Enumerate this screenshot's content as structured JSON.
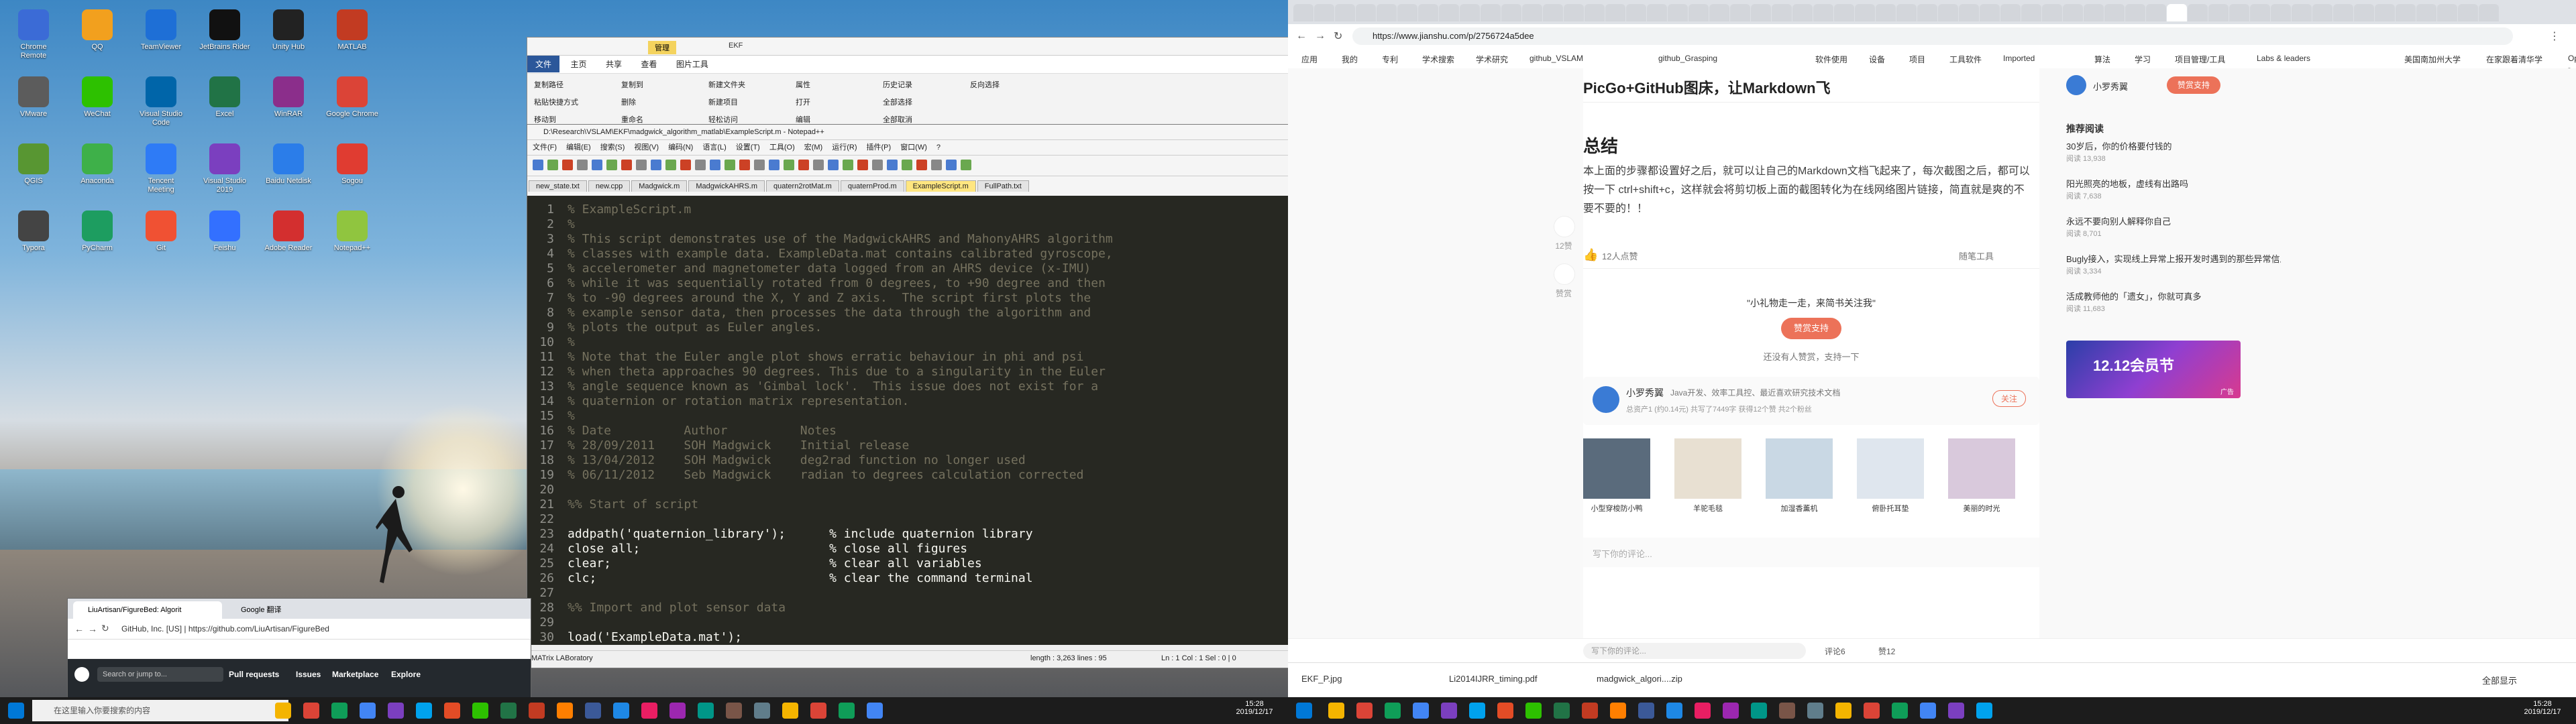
{
  "desktop": {
    "icons": [
      {
        "label": "Chrome Remote Desktop",
        "color": "#3b6bd6"
      },
      {
        "label": "QQ",
        "color": "#f2a01e"
      },
      {
        "label": "TeamViewer",
        "color": "#1e6fd6"
      },
      {
        "label": "JetBrains Rider",
        "color": "#111"
      },
      {
        "label": "Unity Hub",
        "color": "#222"
      },
      {
        "label": "MATLAB",
        "color": "#c23b22"
      },
      {
        "label": "VMware",
        "color": "#5c5c5c"
      },
      {
        "label": "WeChat",
        "color": "#2dc100"
      },
      {
        "label": "Visual Studio Code",
        "color": "#0065a9"
      },
      {
        "label": "Excel",
        "color": "#217346"
      },
      {
        "label": "WinRAR",
        "color": "#8b2e8b"
      },
      {
        "label": "Google Chrome",
        "color": "#db4437"
      },
      {
        "label": "QGIS",
        "color": "#589632"
      },
      {
        "label": "Anaconda",
        "color": "#3eb049"
      },
      {
        "label": "Tencent Meeting",
        "color": "#2e7bf6"
      },
      {
        "label": "Visual Studio 2019",
        "color": "#7b3fbf"
      },
      {
        "label": "Baidu Netdisk",
        "color": "#2b7de9"
      },
      {
        "label": "Sogou",
        "color": "#e03c31"
      },
      {
        "label": "Typora",
        "color": "#444"
      },
      {
        "label": "PyCharm",
        "color": "#1d9d60"
      },
      {
        "label": "Git",
        "color": "#f05133"
      },
      {
        "label": "Feishu",
        "color": "#3370ff"
      },
      {
        "label": "Adobe Reader",
        "color": "#d32f2f"
      },
      {
        "label": "Notepad++",
        "color": "#90c53f"
      }
    ]
  },
  "explorer": {
    "title": "EKF",
    "tabs": [
      "文件",
      "主页",
      "共享",
      "查看",
      "图片工具"
    ],
    "manage_tab": "管理",
    "actions": [
      "复制路径",
      "粘贴快捷方式",
      "移动到",
      "复制到",
      "删除",
      "重命名",
      "新建文件夹",
      "新建项目",
      "轻松访问",
      "属性",
      "打开",
      "编辑",
      "历史记录",
      "全部选择",
      "全部取消",
      "反向选择"
    ]
  },
  "notepad": {
    "title": "D:\\Research\\VSLAM\\EKF\\madgwick_algorithm_matlab\\ExampleScript.m - Notepad++",
    "menu": [
      "文件(F)",
      "编辑(E)",
      "搜索(S)",
      "视图(V)",
      "编码(N)",
      "语言(L)",
      "设置(T)",
      "工具(O)",
      "宏(M)",
      "运行(R)",
      "插件(P)",
      "窗口(W)",
      "?"
    ],
    "tabs": [
      "new_state.txt",
      "new.cpp",
      "Madgwick.m",
      "MadgwickAHRS.m",
      "quatern2rotMat.m",
      "quaternProd.m",
      "ExampleScript.m",
      "FullPath.txt"
    ],
    "active_tab": "ExampleScript.m",
    "lines": [
      {
        "n": "1",
        "text": "% ExampleScript.m",
        "kind": "comment"
      },
      {
        "n": "2",
        "text": "%",
        "kind": "comment"
      },
      {
        "n": "3",
        "text": "% This script demonstrates use of the MadgwickAHRS and MahonyAHRS algorithm",
        "kind": "comment"
      },
      {
        "n": "4",
        "text": "% classes with example data. ExampleData.mat contains calibrated gyroscope,",
        "kind": "comment"
      },
      {
        "n": "5",
        "text": "% accelerometer and magnetometer data logged from an AHRS device (x-IMU)",
        "kind": "comment"
      },
      {
        "n": "6",
        "text": "% while it was sequentially rotated from 0 degrees, to +90 degree and then",
        "kind": "comment"
      },
      {
        "n": "7",
        "text": "% to -90 degrees around the X, Y and Z axis.  The script first plots the",
        "kind": "comment"
      },
      {
        "n": "8",
        "text": "% example sensor data, then processes the data through the algorithm and",
        "kind": "comment"
      },
      {
        "n": "9",
        "text": "% plots the output as Euler angles.",
        "kind": "comment"
      },
      {
        "n": "10",
        "text": "%",
        "kind": "comment"
      },
      {
        "n": "11",
        "text": "% Note that the Euler angle plot shows erratic behaviour in phi and psi",
        "kind": "comment"
      },
      {
        "n": "12",
        "text": "% when theta approaches 90 degrees. This due to a singularity in the Euler",
        "kind": "comment"
      },
      {
        "n": "13",
        "text": "% angle sequence known as 'Gimbal lock'.  This issue does not exist for a",
        "kind": "comment"
      },
      {
        "n": "14",
        "text": "% quaternion or rotation matrix representation.",
        "kind": "comment"
      },
      {
        "n": "15",
        "text": "%",
        "kind": "comment"
      },
      {
        "n": "16",
        "text": "% Date          Author          Notes",
        "kind": "comment"
      },
      {
        "n": "17",
        "text": "% 28/09/2011    SOH Madgwick    Initial release",
        "kind": "comment"
      },
      {
        "n": "18",
        "text": "% 13/04/2012    SOH Madgwick    deg2rad function no longer used",
        "kind": "comment"
      },
      {
        "n": "19",
        "text": "% 06/11/2012    Seb Madgwick    radian to degrees calculation corrected",
        "kind": "comment"
      },
      {
        "n": "20",
        "text": "",
        "kind": "comment"
      },
      {
        "n": "21",
        "text": "%% Start of script",
        "kind": "comment"
      },
      {
        "n": "22",
        "text": "",
        "kind": "comment"
      },
      {
        "n": "23",
        "text": "addpath('quaternion_library');      % include quaternion library",
        "kind": "code"
      },
      {
        "n": "24",
        "text": "close all;                          % close all figures",
        "kind": "code"
      },
      {
        "n": "25",
        "text": "clear;                              % clear all variables",
        "kind": "code"
      },
      {
        "n": "26",
        "text": "clc;                                % clear the command terminal",
        "kind": "code"
      },
      {
        "n": "27",
        "text": "",
        "kind": "comment"
      },
      {
        "n": "28",
        "text": "%% Import and plot sensor data",
        "kind": "comment"
      },
      {
        "n": "29",
        "text": "",
        "kind": "comment"
      },
      {
        "n": "30",
        "text": "load('ExampleData.mat');",
        "kind": "code"
      }
    ],
    "status": {
      "lang": "MATrix LABoratory",
      "length": "length : 3,263    lines : 95",
      "pos": "Ln : 1    Col : 1    Sel : 0 | 0"
    }
  },
  "github_window": {
    "tab1": "LiuArtisan/FigureBed: Algorit",
    "tab2": "Google 翻译",
    "url": "GitHub, Inc. [US] | https://github.com/LiuArtisan/FigureBed",
    "search": "Search or jump to...",
    "nav": [
      "Pull requests",
      "Issues",
      "Marketplace",
      "Explore"
    ]
  },
  "taskbar_left": {
    "search_placeholder": "在这里输入你要搜索的内容",
    "time": "15:28",
    "date": "2019/12/17"
  },
  "browser": {
    "url": "https://www.jianshu.com/p/2756724a5dee",
    "bookmarks": [
      "应用",
      "我的",
      "专利",
      "学术搜索",
      "学术研究",
      "github_VSLAM",
      "github_Grasping",
      "软件使用",
      "设备",
      "项目",
      "工具软件",
      "Imported",
      "算法",
      "学习",
      "项目管理/工具",
      "Labs & leaders",
      "美国南加州大学",
      "在家跟着清华学",
      "OpenGL - GLUT..."
    ],
    "header_title": "PicGo+GitHub图床，让Markdown飞",
    "author_name": "小罗秀翼",
    "header_btn": "赞赏支持",
    "section_title": "总结",
    "para": "本上面的步骤都设置好之后，就可以让自己的Markdown文档飞起来了，每次截图之后，都可以按一下 ctrl+shift+c，这样就会将剪切板上面的截图转化为在线网络图片链接，简直就是爽的不要不要的！！",
    "like_count": "12人点赞",
    "author_menu": "随笔工具",
    "reward_text": "\"小礼物走一走，来简书关注我\"",
    "reward_btn": "赞赏支持",
    "reward_none": "还没有人赞赏，支持一下",
    "author_desc": "Java开发、效率工具控、最近喜欢研究技术文档",
    "author_stats": "总资产1 (约0.14元)   共写了7449字   获得12个赞   共2个粉丝",
    "follow_btn": "关注",
    "likes_side": "12赞",
    "reward_side": "赞赏",
    "thumbs": [
      "小型穿梭防小鸭",
      "羊驼毛毯",
      "加湿香薰机",
      "俯卧托耳垫",
      "美丽的时光"
    ],
    "sidebar_title": "推荐阅读",
    "recs": [
      {
        "t": "30岁后，你的价格要付钱的",
        "s": "阅读 13,938"
      },
      {
        "t": "阳光照亮的地板，虚线有出路吗",
        "s": "阅读 7,638"
      },
      {
        "t": "永远不要向别人解释你自己",
        "s": "阅读 8,701"
      },
      {
        "t": "Bugly接入，实现线上异常上报开发时遇到的那些异常信息发送给开发者",
        "s": "阅读 3,334"
      },
      {
        "t": "活成教师他的「遗女」，你就可真多",
        "s": "阅读 11,683"
      }
    ],
    "ad_text": "12.12会员节",
    "ad_sub": "广告",
    "comment_placeholder": "写下你的评论...",
    "comment_count": "评论6",
    "likes_count": "赞12",
    "comment_box": "写下你的评论...",
    "downloads": [
      "EKF_P.jpg",
      "Li2014IJRR_timing.pdf",
      "madgwick_algori....zip"
    ],
    "show_all": "全部显示"
  },
  "taskbar_right": {
    "time": "15:28",
    "date": "2019/12/17"
  }
}
